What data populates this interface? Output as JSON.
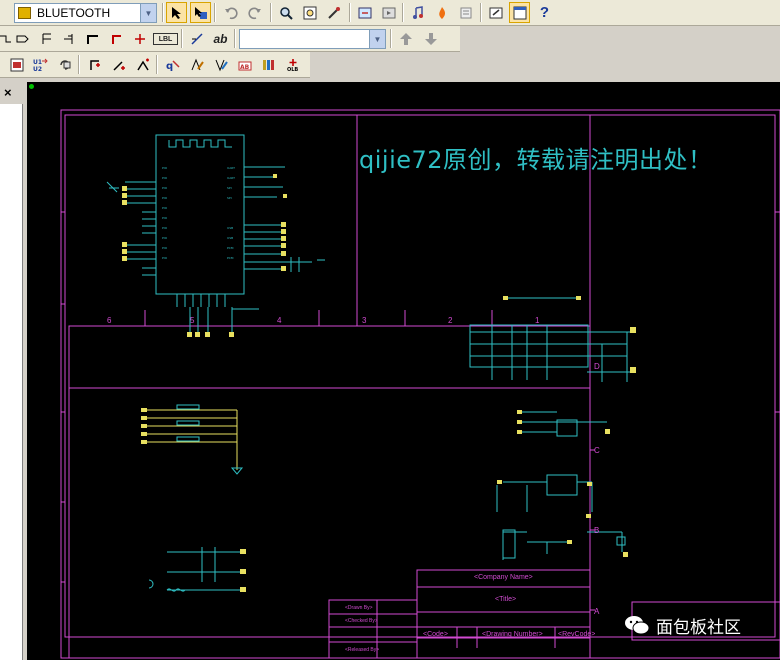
{
  "toolbar": {
    "part_selector_value": "BLUETOOTH",
    "text_button_label": "ab",
    "lbl_button_label": "LBL",
    "help_button_label": "?"
  },
  "left_panel": {
    "close_glyph": "×"
  },
  "schematic": {
    "banner_text": "qijie72原创，转载请注明出处！",
    "watermark_text": "面包板社区",
    "grid_columns": [
      "6",
      "5",
      "4",
      "3",
      "2",
      "1"
    ],
    "grid_rows": [
      "D",
      "C",
      "B",
      "A"
    ],
    "title_block": {
      "company_name": "<Company Name>",
      "title": "<Title>",
      "code": "<Code>",
      "drawing_number": "<Drawing Number>",
      "revision": "<RevCode>",
      "drawn_by": "<Drawn By>",
      "checked_by": "<Checked By>",
      "released_by": "<Released By>"
    }
  },
  "colors": {
    "border": "#d24ad2",
    "wire": "#2fbfc4",
    "pin": "#e8e060",
    "canvas_bg": "#000000",
    "toolbar_bg": "#ece9d8"
  }
}
